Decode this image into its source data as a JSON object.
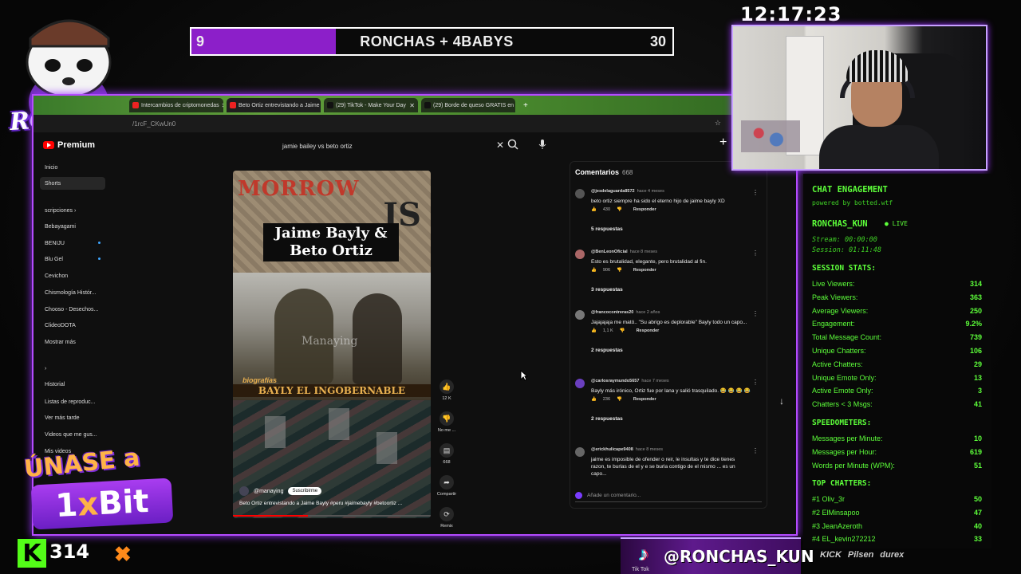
{
  "goal": {
    "left": "9",
    "center": "RONCHAS + 4BABYS",
    "right": "30",
    "fill_fraction": 0.3
  },
  "clock": "12:17:23",
  "brand": "RONCHAS",
  "browser": {
    "tabs": [
      {
        "label": "Intercambios de criptomonedas",
        "active": false,
        "color": "#e22"
      },
      {
        "label": "Beto Ortiz entrevistando a Jaime",
        "active": true,
        "color": "#e22"
      },
      {
        "label": "(29) TikTok - Make Your Day",
        "active": false,
        "color": "#111"
      },
      {
        "label": "(29) Borde de queso GRATIS en",
        "active": false,
        "color": "#111"
      }
    ],
    "url": "/1rcF_CKwUn0"
  },
  "youtube": {
    "logo": "Premium",
    "search_value": "jamie bailey vs beto ortiz",
    "sidebar": [
      {
        "label": "Inicio",
        "selected": false,
        "dot": false
      },
      {
        "label": "Shorts",
        "selected": true,
        "dot": false
      },
      {
        "label": "scripciones  ›",
        "selected": false,
        "dot": false
      },
      {
        "label": "Bebayagami",
        "selected": false,
        "dot": false
      },
      {
        "label": "BENIJU",
        "selected": false,
        "dot": true
      },
      {
        "label": "Blu Gel",
        "selected": false,
        "dot": true
      },
      {
        "label": "Cevichon",
        "selected": false,
        "dot": false
      },
      {
        "label": "Chismología Histór...",
        "selected": false,
        "dot": false
      },
      {
        "label": "Chooso - Desechos...",
        "selected": false,
        "dot": false
      },
      {
        "label": "ClideoDOTA",
        "selected": false,
        "dot": false
      },
      {
        "label": "Mostrar más",
        "selected": false,
        "dot": false
      },
      {
        "label": "›",
        "selected": false,
        "dot": false
      },
      {
        "label": "Historial",
        "selected": false,
        "dot": false
      },
      {
        "label": "Listas de reproduc...",
        "selected": false,
        "dot": false
      },
      {
        "label": "Ver más tarde",
        "selected": false,
        "dot": false
      },
      {
        "label": "Videos que me gus...",
        "selected": false,
        "dot": false
      },
      {
        "label": "Mis videos",
        "selected": false,
        "dot": false
      }
    ],
    "short": {
      "top_text": "MORROW",
      "top_text2": "IS",
      "title_line1": "Jaime Bayly &",
      "title_line2": "Beto Ortiz",
      "watermark": "Manaying",
      "banner": "BAYLY EL INGOBERNABLE",
      "banner_tag": "biografías",
      "channel": "@manaying",
      "subscribe": "Suscribirme",
      "caption": "Beto Ortiz entrevistando a Jaime Bayly #peru #jaimebayly #betoortiz ...",
      "progress_fraction": 0.38
    },
    "actions": [
      {
        "icon": "like-icon",
        "label": "12 K"
      },
      {
        "icon": "dislike-icon",
        "label": "No me ..."
      },
      {
        "icon": "comments-icon",
        "label": "668"
      },
      {
        "icon": "share-icon",
        "label": "Compartir"
      },
      {
        "icon": "remix-icon",
        "label": "Remix"
      }
    ],
    "comments": {
      "title": "Comentarios",
      "count": "668",
      "items": [
        {
          "author": "@jesdelaguarda8572",
          "time": "hace 4 meses",
          "text": "beto ortiz siempre ha sido el eterno hijo de jaime bayly XD",
          "likes": "430",
          "reply": "Responder",
          "replies": "5 respuestas",
          "avatar_color": "#555"
        },
        {
          "author": "@BenLeonOficial",
          "time": "hace 8 meses",
          "text": "Esto es brutalidad, elegante, pero brutalidad al fin.",
          "likes": "906",
          "reply": "Responder",
          "replies": "3 respuestas",
          "avatar_color": "#a66"
        },
        {
          "author": "@francocontreras20",
          "time": "hace 2 años",
          "text": "Jajajajaja me mató.. \"Su abrigo es deplorable\" Bayly todo un capo...",
          "likes": "1,1 K",
          "reply": "Responder",
          "replies": "2 respuestas",
          "avatar_color": "#777"
        },
        {
          "author": "@carlosraymundo5657",
          "time": "hace 7 meses",
          "text": "Bayly más irónico, Ortiz fue por lana y salió trasquilado. 😂 😂 😂 😂",
          "likes": "236",
          "reply": "Responder",
          "replies": "2 respuestas",
          "avatar_color": "#6a3fbf"
        },
        {
          "author": "@erickhulicape9408",
          "time": "hace 8 meses",
          "text": "jaime es imposible de ofender o reir, le insultas y te dice tienes razon, te burlas de el y e se burla contigo de el mismo ... es un capo...",
          "likes": "",
          "reply": "",
          "replies": "",
          "avatar_color": "#666"
        }
      ],
      "add_placeholder": "Añade un comentario..."
    }
  },
  "engagement": {
    "title": "CHAT ENGAGEMENT",
    "powered": "powered by botted.wtf",
    "channel": "RONCHAS_KUN",
    "live": "● LIVE",
    "stream": "Stream: 00:00:00",
    "session": "Session: 01:11:48",
    "session_title": "SESSION STATS:",
    "stats": [
      {
        "label": "Live Viewers:",
        "value": "314"
      },
      {
        "label": "Peak Viewers:",
        "value": "363"
      },
      {
        "label": "Average Viewers:",
        "value": "250"
      },
      {
        "label": "Engagement:",
        "value": "9.2%"
      },
      {
        "label": "Total Message Count:",
        "value": "739"
      },
      {
        "label": "Unique Chatters:",
        "value": "106"
      },
      {
        "label": "Active Chatters:",
        "value": "29"
      },
      {
        "label": "Unique Emote Only:",
        "value": "13"
      },
      {
        "label": "Active Emote Only:",
        "value": "3"
      },
      {
        "label": "Chatters < 3 Msgs:",
        "value": "41"
      }
    ],
    "speed_title": "SPEEDOMETERS:",
    "speed": [
      {
        "label": "Messages per Minute:",
        "value": "10"
      },
      {
        "label": "Messages per Hour:",
        "value": "619"
      },
      {
        "label": "Words per Minute (WPM):",
        "value": "51"
      }
    ],
    "top_title": "TOP CHATTERS:",
    "top": [
      {
        "label": "#1 Oliv_3r",
        "value": "50"
      },
      {
        "label": "#2 ElMinsapoo",
        "value": "47"
      },
      {
        "label": "#3 JeanAzeroth",
        "value": "40"
      },
      {
        "label": "#4 EL_kevin272212",
        "value": "33"
      }
    ]
  },
  "kick": {
    "icon": "K",
    "viewers": "314"
  },
  "promo": {
    "line1": "ÚNASE a",
    "line2a": "1",
    "line2b": "x",
    "line2c": "Bit"
  },
  "tiktok": {
    "handle": "@RONCHAS_KUN",
    "label": "Tik Tok"
  },
  "sponsors": [
    "KICK",
    "Pilsen",
    "durex"
  ],
  "colors": {
    "accent": "#b44bff",
    "goal_fill": "#8c1fc9",
    "stats_green": "#5dff3a",
    "kick_green": "#53fc18"
  }
}
